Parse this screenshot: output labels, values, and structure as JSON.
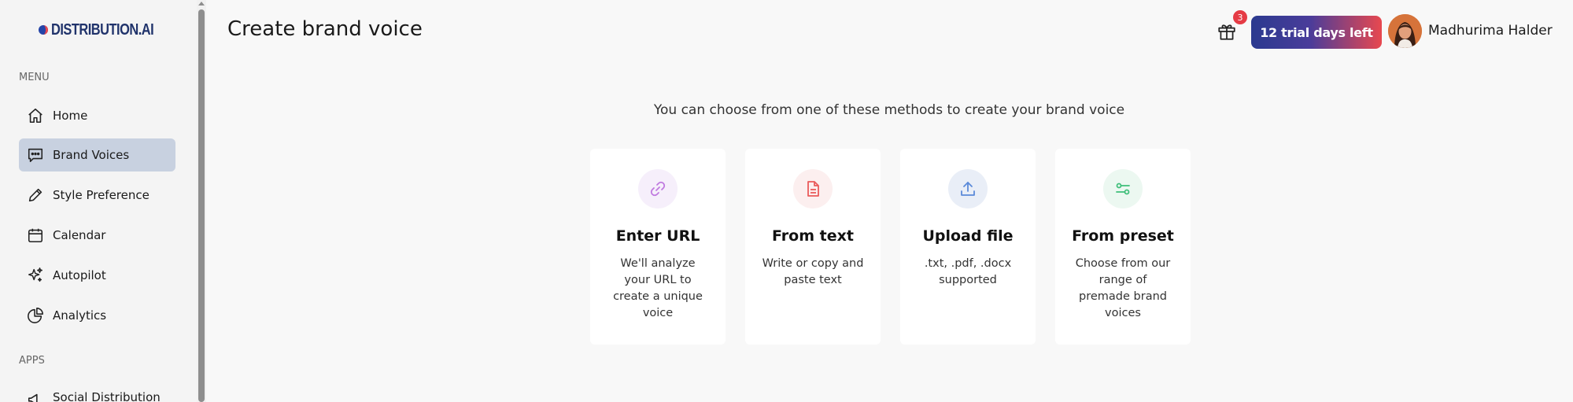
{
  "sidebar": {
    "logo_text": "DISTRIBUTION.AI",
    "menu_label": "MENU",
    "apps_label": "APPS",
    "items": [
      {
        "label": "Home",
        "icon": "home-icon"
      },
      {
        "label": "Brand Voices",
        "icon": "chat-bubble-icon",
        "active": true
      },
      {
        "label": "Style Preference",
        "icon": "pencil-icon"
      },
      {
        "label": "Calendar",
        "icon": "calendar-icon"
      },
      {
        "label": "Autopilot",
        "icon": "sparkles-icon"
      },
      {
        "label": "Analytics",
        "icon": "pie-chart-icon"
      }
    ],
    "apps": [
      {
        "label": "Social Distribution",
        "icon": "megaphone-icon"
      }
    ]
  },
  "header": {
    "title": "Create brand voice",
    "gift_badge": "3",
    "trial_label": "12 trial days left",
    "user_name": "Madhurima Halder"
  },
  "main": {
    "intro": "You can choose from one of these methods to create your brand voice",
    "cards": [
      {
        "title": "Enter URL",
        "desc": "We'll analyze your URL to create a unique voice",
        "icon": "link-icon",
        "accent": "#c07ae0",
        "bg": "#f6effb"
      },
      {
        "title": "From text",
        "desc": "Write or copy and paste text",
        "icon": "document-icon",
        "accent": "#ea5b5b",
        "bg": "#fcefef"
      },
      {
        "title": "Upload file",
        "desc": ".txt, .pdf, .docx supported",
        "icon": "upload-icon",
        "accent": "#5b8ad9",
        "bg": "#e9eef7"
      },
      {
        "title": "From preset",
        "desc": "Choose from our range of premade brand voices",
        "icon": "sliders-icon",
        "accent": "#3fbf7a",
        "bg": "#ecf8f1"
      }
    ]
  },
  "colors": {
    "trial_gradient_start": "#2b3a8f",
    "trial_gradient_end": "#e8484f",
    "active_nav_bg": "#c8d1e0",
    "badge": "#e53b45"
  }
}
